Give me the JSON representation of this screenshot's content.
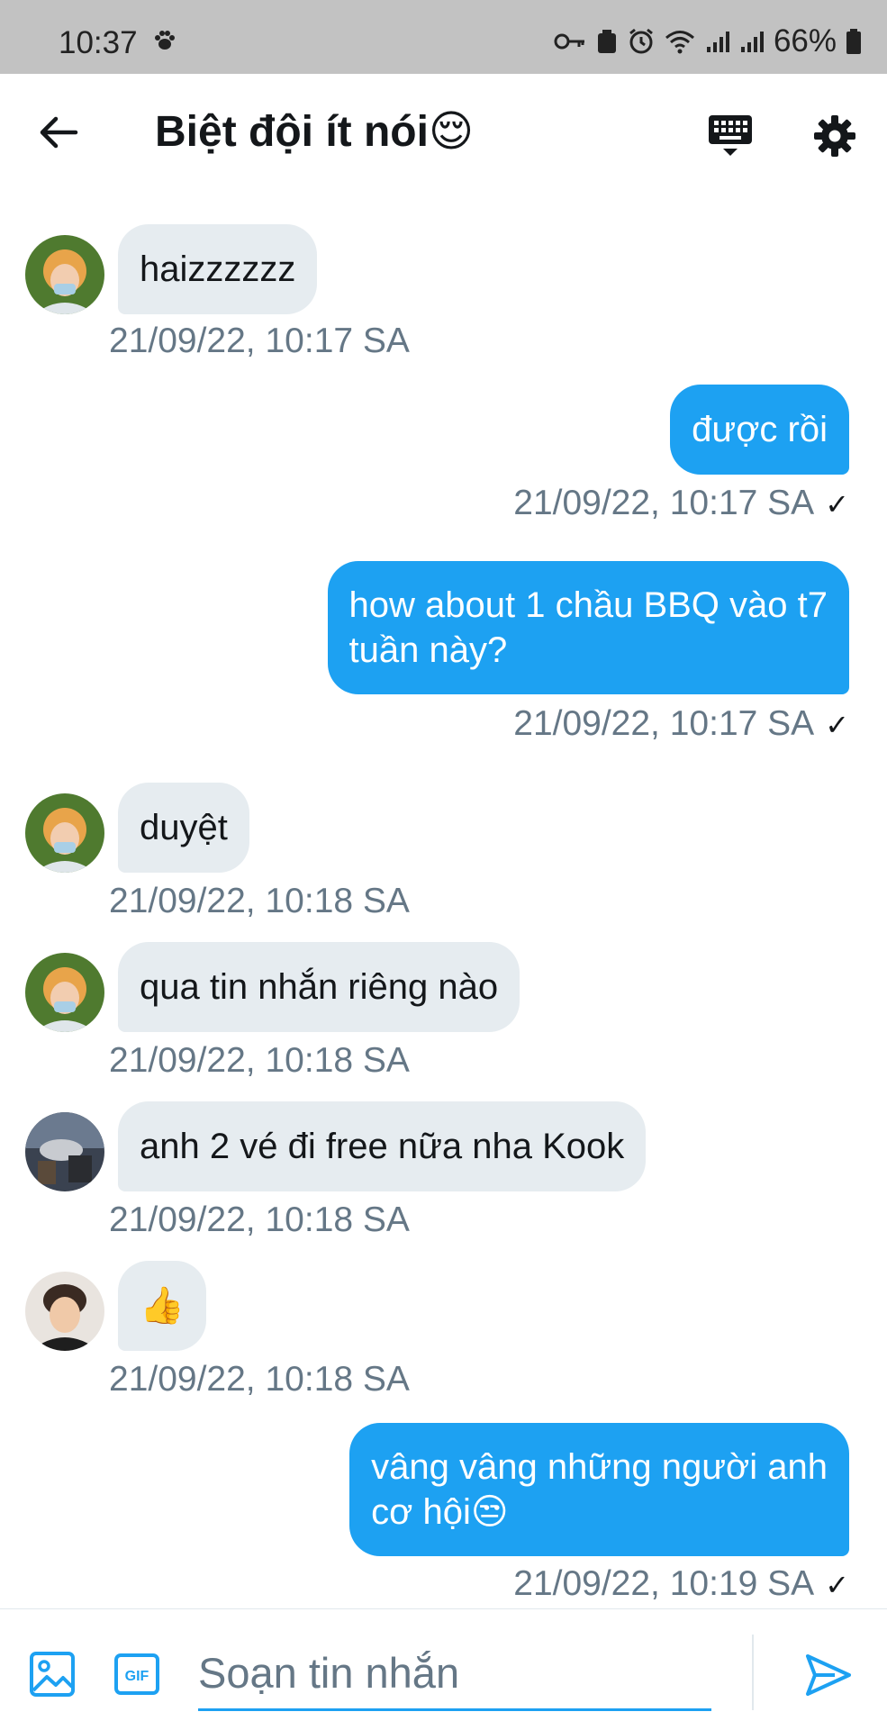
{
  "status_bar": {
    "time": "10:37",
    "battery": "66%"
  },
  "header": {
    "title": "Biệt đội ít nói😌"
  },
  "messages": [
    {
      "side": "in",
      "text": "haizzzzzz",
      "time": "21/09/22, 10:17 SA",
      "avatar": "green"
    },
    {
      "side": "out",
      "text": "được rồi",
      "time": "21/09/22, 10:17 SA"
    },
    {
      "side": "out",
      "text": "how about 1 chầu BBQ vào t7",
      "text2": "tuần này?",
      "time": "21/09/22, 10:17 SA"
    },
    {
      "side": "in",
      "text": "duyệt",
      "time": "21/09/22, 10:18 SA",
      "avatar": "green"
    },
    {
      "side": "in",
      "text": "qua tin nhắn riêng nào",
      "time": "21/09/22, 10:18 SA",
      "avatar": "green"
    },
    {
      "side": "in",
      "text": "anh 2 vé đi free nữa nha Kook",
      "time": "21/09/22, 10:18 SA",
      "avatar": "dark"
    },
    {
      "side": "in",
      "text": "👍",
      "time": "21/09/22, 10:18 SA",
      "avatar": "light"
    },
    {
      "side": "out",
      "text": "vâng vâng những người anh",
      "text2": "cơ hội😒",
      "time": "21/09/22, 10:19 SA"
    }
  ],
  "composer": {
    "placeholder": "Soạn tin nhắn"
  },
  "colors": {
    "accent": "#1da1f2",
    "incoming_bubble": "#e6ecf0",
    "timestamp": "#657786"
  },
  "icons": [
    "paw-icon",
    "key-icon",
    "alarm-icon",
    "wifi-icon",
    "signal-icon",
    "battery-icon",
    "back-arrow-icon",
    "keyboard-icon",
    "gear-icon",
    "image-icon",
    "gif-icon",
    "send-icon",
    "check-icon"
  ]
}
